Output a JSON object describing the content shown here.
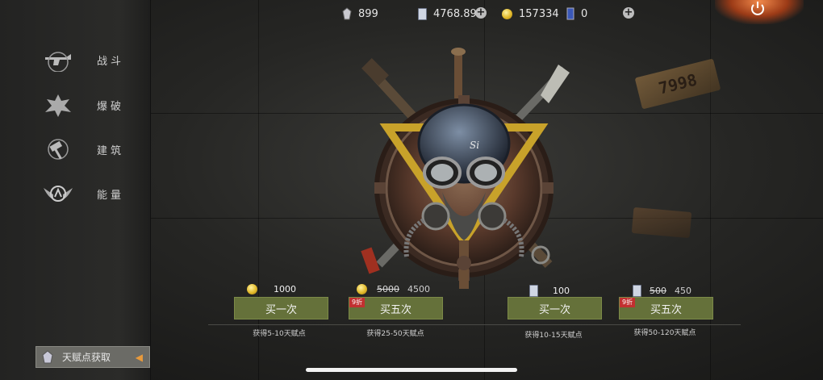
{
  "topbar": {
    "gems": "899",
    "cards": "4768.89",
    "coins": "157334",
    "tickets": "0"
  },
  "sidebar": {
    "items": [
      {
        "label": "战斗",
        "icon": "gun-icon"
      },
      {
        "label": "爆破",
        "icon": "explosion-icon"
      },
      {
        "label": "建筑",
        "icon": "hammer-icon"
      },
      {
        "label": "能量",
        "icon": "winged-emblem-icon"
      }
    ],
    "get_talent_label": "天赋点获取"
  },
  "decor": {
    "plate_text": "7998"
  },
  "offers": [
    {
      "price": "1000",
      "currency": "coin",
      "button": "买一次",
      "note": "获得5-10天赋点"
    },
    {
      "old_price": "5000",
      "price": "4500",
      "currency": "coin",
      "button": "买五次",
      "discount": "9折",
      "note": "获得25-50天赋点"
    },
    {
      "price": "100",
      "currency": "card",
      "button": "买一次",
      "note": "获得10-15天赋点"
    },
    {
      "old_price": "500",
      "price": "450",
      "currency": "card",
      "button": "买五次",
      "discount": "9折",
      "note": "获得50-120天赋点"
    }
  ],
  "colors": {
    "button_green": "#65713a",
    "discount_red": "#c23030",
    "power_glow": "#f0884a"
  }
}
